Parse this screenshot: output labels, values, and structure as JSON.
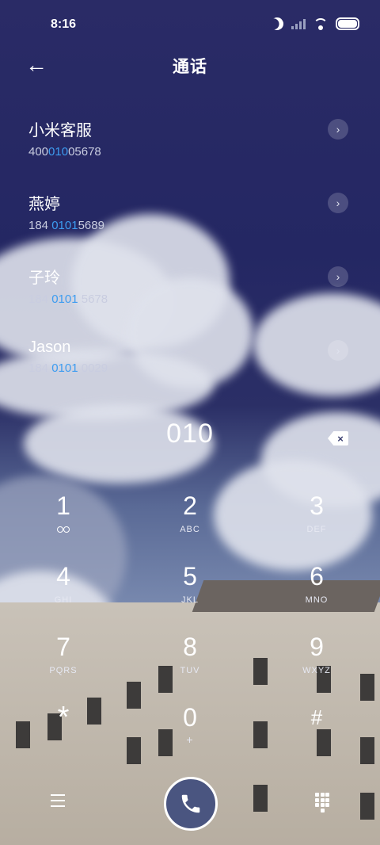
{
  "status_bar": {
    "time": "8:16"
  },
  "header": {
    "title": "通话",
    "back_icon": "←"
  },
  "contacts": [
    {
      "name": "小米客服",
      "number_parts": [
        "400",
        "010",
        "05678"
      ]
    },
    {
      "name": "燕婷",
      "number_parts": [
        "184 ",
        "0101",
        "5689"
      ]
    },
    {
      "name": "子玲",
      "number_parts": [
        "184 ",
        "0101",
        " 5678"
      ]
    },
    {
      "name": "Jason",
      "number_parts": [
        "184 ",
        "0101",
        " 0029"
      ]
    }
  ],
  "dialpad": {
    "input_value": "010",
    "backspace_icon": "×",
    "keys": [
      {
        "digit": "1",
        "letters": ""
      },
      {
        "digit": "2",
        "letters": "ABC"
      },
      {
        "digit": "3",
        "letters": "DEF"
      },
      {
        "digit": "4",
        "letters": "GHI"
      },
      {
        "digit": "5",
        "letters": "JKL"
      },
      {
        "digit": "6",
        "letters": "MNO"
      },
      {
        "digit": "7",
        "letters": "PQRS"
      },
      {
        "digit": "8",
        "letters": "TUV"
      },
      {
        "digit": "9",
        "letters": "WXYZ"
      },
      {
        "digit": "*",
        "letters": ""
      },
      {
        "digit": "0",
        "letters": "+"
      },
      {
        "digit": "#",
        "letters": ""
      }
    ]
  },
  "colors": {
    "highlight": "#3d9cf0",
    "call_button": "#4a5580"
  }
}
